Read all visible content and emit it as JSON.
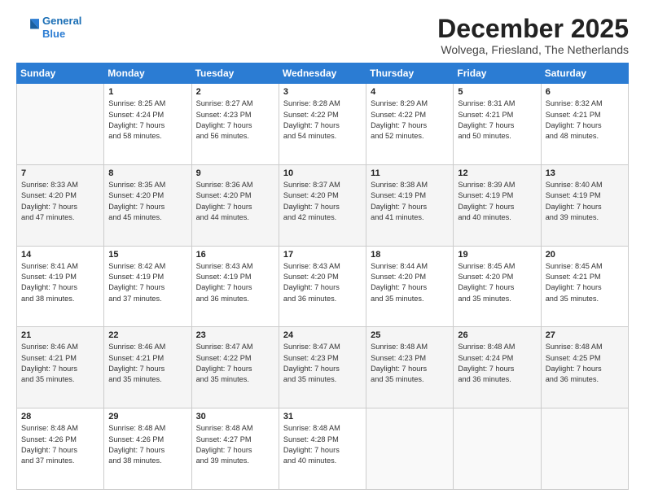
{
  "logo": {
    "line1": "General",
    "line2": "Blue"
  },
  "title": "December 2025",
  "subtitle": "Wolvega, Friesland, The Netherlands",
  "header_days": [
    "Sunday",
    "Monday",
    "Tuesday",
    "Wednesday",
    "Thursday",
    "Friday",
    "Saturday"
  ],
  "weeks": [
    [
      {
        "day": "",
        "info": ""
      },
      {
        "day": "1",
        "info": "Sunrise: 8:25 AM\nSunset: 4:24 PM\nDaylight: 7 hours\nand 58 minutes."
      },
      {
        "day": "2",
        "info": "Sunrise: 8:27 AM\nSunset: 4:23 PM\nDaylight: 7 hours\nand 56 minutes."
      },
      {
        "day": "3",
        "info": "Sunrise: 8:28 AM\nSunset: 4:22 PM\nDaylight: 7 hours\nand 54 minutes."
      },
      {
        "day": "4",
        "info": "Sunrise: 8:29 AM\nSunset: 4:22 PM\nDaylight: 7 hours\nand 52 minutes."
      },
      {
        "day": "5",
        "info": "Sunrise: 8:31 AM\nSunset: 4:21 PM\nDaylight: 7 hours\nand 50 minutes."
      },
      {
        "day": "6",
        "info": "Sunrise: 8:32 AM\nSunset: 4:21 PM\nDaylight: 7 hours\nand 48 minutes."
      }
    ],
    [
      {
        "day": "7",
        "info": "Sunrise: 8:33 AM\nSunset: 4:20 PM\nDaylight: 7 hours\nand 47 minutes."
      },
      {
        "day": "8",
        "info": "Sunrise: 8:35 AM\nSunset: 4:20 PM\nDaylight: 7 hours\nand 45 minutes."
      },
      {
        "day": "9",
        "info": "Sunrise: 8:36 AM\nSunset: 4:20 PM\nDaylight: 7 hours\nand 44 minutes."
      },
      {
        "day": "10",
        "info": "Sunrise: 8:37 AM\nSunset: 4:20 PM\nDaylight: 7 hours\nand 42 minutes."
      },
      {
        "day": "11",
        "info": "Sunrise: 8:38 AM\nSunset: 4:19 PM\nDaylight: 7 hours\nand 41 minutes."
      },
      {
        "day": "12",
        "info": "Sunrise: 8:39 AM\nSunset: 4:19 PM\nDaylight: 7 hours\nand 40 minutes."
      },
      {
        "day": "13",
        "info": "Sunrise: 8:40 AM\nSunset: 4:19 PM\nDaylight: 7 hours\nand 39 minutes."
      }
    ],
    [
      {
        "day": "14",
        "info": "Sunrise: 8:41 AM\nSunset: 4:19 PM\nDaylight: 7 hours\nand 38 minutes."
      },
      {
        "day": "15",
        "info": "Sunrise: 8:42 AM\nSunset: 4:19 PM\nDaylight: 7 hours\nand 37 minutes."
      },
      {
        "day": "16",
        "info": "Sunrise: 8:43 AM\nSunset: 4:19 PM\nDaylight: 7 hours\nand 36 minutes."
      },
      {
        "day": "17",
        "info": "Sunrise: 8:43 AM\nSunset: 4:20 PM\nDaylight: 7 hours\nand 36 minutes."
      },
      {
        "day": "18",
        "info": "Sunrise: 8:44 AM\nSunset: 4:20 PM\nDaylight: 7 hours\nand 35 minutes."
      },
      {
        "day": "19",
        "info": "Sunrise: 8:45 AM\nSunset: 4:20 PM\nDaylight: 7 hours\nand 35 minutes."
      },
      {
        "day": "20",
        "info": "Sunrise: 8:45 AM\nSunset: 4:21 PM\nDaylight: 7 hours\nand 35 minutes."
      }
    ],
    [
      {
        "day": "21",
        "info": "Sunrise: 8:46 AM\nSunset: 4:21 PM\nDaylight: 7 hours\nand 35 minutes."
      },
      {
        "day": "22",
        "info": "Sunrise: 8:46 AM\nSunset: 4:21 PM\nDaylight: 7 hours\nand 35 minutes."
      },
      {
        "day": "23",
        "info": "Sunrise: 8:47 AM\nSunset: 4:22 PM\nDaylight: 7 hours\nand 35 minutes."
      },
      {
        "day": "24",
        "info": "Sunrise: 8:47 AM\nSunset: 4:23 PM\nDaylight: 7 hours\nand 35 minutes."
      },
      {
        "day": "25",
        "info": "Sunrise: 8:48 AM\nSunset: 4:23 PM\nDaylight: 7 hours\nand 35 minutes."
      },
      {
        "day": "26",
        "info": "Sunrise: 8:48 AM\nSunset: 4:24 PM\nDaylight: 7 hours\nand 36 minutes."
      },
      {
        "day": "27",
        "info": "Sunrise: 8:48 AM\nSunset: 4:25 PM\nDaylight: 7 hours\nand 36 minutes."
      }
    ],
    [
      {
        "day": "28",
        "info": "Sunrise: 8:48 AM\nSunset: 4:26 PM\nDaylight: 7 hours\nand 37 minutes."
      },
      {
        "day": "29",
        "info": "Sunrise: 8:48 AM\nSunset: 4:26 PM\nDaylight: 7 hours\nand 38 minutes."
      },
      {
        "day": "30",
        "info": "Sunrise: 8:48 AM\nSunset: 4:27 PM\nDaylight: 7 hours\nand 39 minutes."
      },
      {
        "day": "31",
        "info": "Sunrise: 8:48 AM\nSunset: 4:28 PM\nDaylight: 7 hours\nand 40 minutes."
      },
      {
        "day": "",
        "info": ""
      },
      {
        "day": "",
        "info": ""
      },
      {
        "day": "",
        "info": ""
      }
    ]
  ]
}
